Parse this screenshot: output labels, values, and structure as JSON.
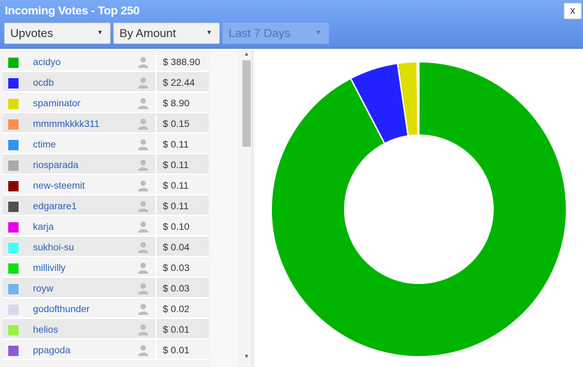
{
  "header": {
    "title": "Incoming Votes - Top 250",
    "close_label": "x",
    "vote_type": "Upvotes",
    "sort_by": "By Amount",
    "period": "Last 7 Days"
  },
  "votes": [
    {
      "name": "acidyo",
      "amount": "$ 388.90",
      "color": "#00b400"
    },
    {
      "name": "ocdb",
      "amount": "$ 22.44",
      "color": "#2222ff"
    },
    {
      "name": "spaminator",
      "amount": "$ 8.90",
      "color": "#dddd00"
    },
    {
      "name": "mmmmkkkk311",
      "amount": "$ 0.15",
      "color": "#ff9148"
    },
    {
      "name": "ctime",
      "amount": "$ 0.11",
      "color": "#2a95f2"
    },
    {
      "name": "riosparada",
      "amount": "$ 0.11",
      "color": "#a8a8a8"
    },
    {
      "name": "new-steemit",
      "amount": "$ 0.11",
      "color": "#8c0000"
    },
    {
      "name": "edgarare1",
      "amount": "$ 0.11",
      "color": "#505050"
    },
    {
      "name": "karja",
      "amount": "$ 0.10",
      "color": "#e600e6"
    },
    {
      "name": "sukhoi-su",
      "amount": "$ 0.04",
      "color": "#40ffff"
    },
    {
      "name": "millivilly",
      "amount": "$ 0.03",
      "color": "#10e010"
    },
    {
      "name": "royw",
      "amount": "$ 0.03",
      "color": "#6eb4f2"
    },
    {
      "name": "godofthunder",
      "amount": "$ 0.02",
      "color": "#dcd4ec"
    },
    {
      "name": "helios",
      "amount": "$ 0.01",
      "color": "#9af040"
    },
    {
      "name": "ppagoda",
      "amount": "$ 0.01",
      "color": "#8c5ad8"
    }
  ],
  "chart_data": {
    "type": "pie",
    "categories": [
      "acidyo",
      "ocdb",
      "spaminator",
      "mmmmkkkk311",
      "ctime",
      "riosparada",
      "new-steemit",
      "edgarare1",
      "karja",
      "sukhoi-su",
      "millivilly",
      "royw",
      "godofthunder",
      "helios",
      "ppagoda"
    ],
    "values": [
      388.9,
      22.44,
      8.9,
      0.15,
      0.11,
      0.11,
      0.11,
      0.11,
      0.1,
      0.04,
      0.03,
      0.03,
      0.02,
      0.01,
      0.01
    ],
    "colors": [
      "#00b400",
      "#2222ff",
      "#dddd00",
      "#ff9148",
      "#2a95f2",
      "#a8a8a8",
      "#8c0000",
      "#505050",
      "#e600e6",
      "#40ffff",
      "#10e010",
      "#6eb4f2",
      "#dcd4ec",
      "#9af040",
      "#8c5ad8"
    ],
    "donut": true,
    "title": "",
    "xlabel": "",
    "ylabel": ""
  }
}
